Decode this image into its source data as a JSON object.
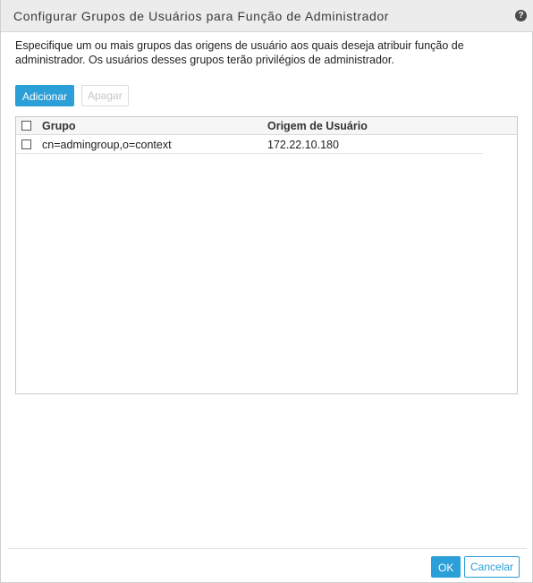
{
  "dialog": {
    "title": "Configurar Grupos de Usuários para Função de Administrador",
    "help_icon": "question-circle-icon",
    "help_glyph": "?",
    "description": "Especifique um ou mais grupos das origens de usuário aos quais deseja atribuir função de administrador. Os usuários desses grupos terão privilégios de administrador."
  },
  "toolbar": {
    "add_label": "Adicionar",
    "delete_label": "Apagar"
  },
  "table": {
    "columns": [
      "Grupo",
      "Origem de Usuário"
    ],
    "rows": [
      {
        "group": "cn=admingroup,o=context",
        "source": "172.22.10.180",
        "checked": false
      }
    ]
  },
  "footer": {
    "ok_label": "OK",
    "cancel_label": "Cancelar"
  },
  "colors": {
    "accent": "#2a9fd8",
    "title_bar": "#ececec"
  }
}
